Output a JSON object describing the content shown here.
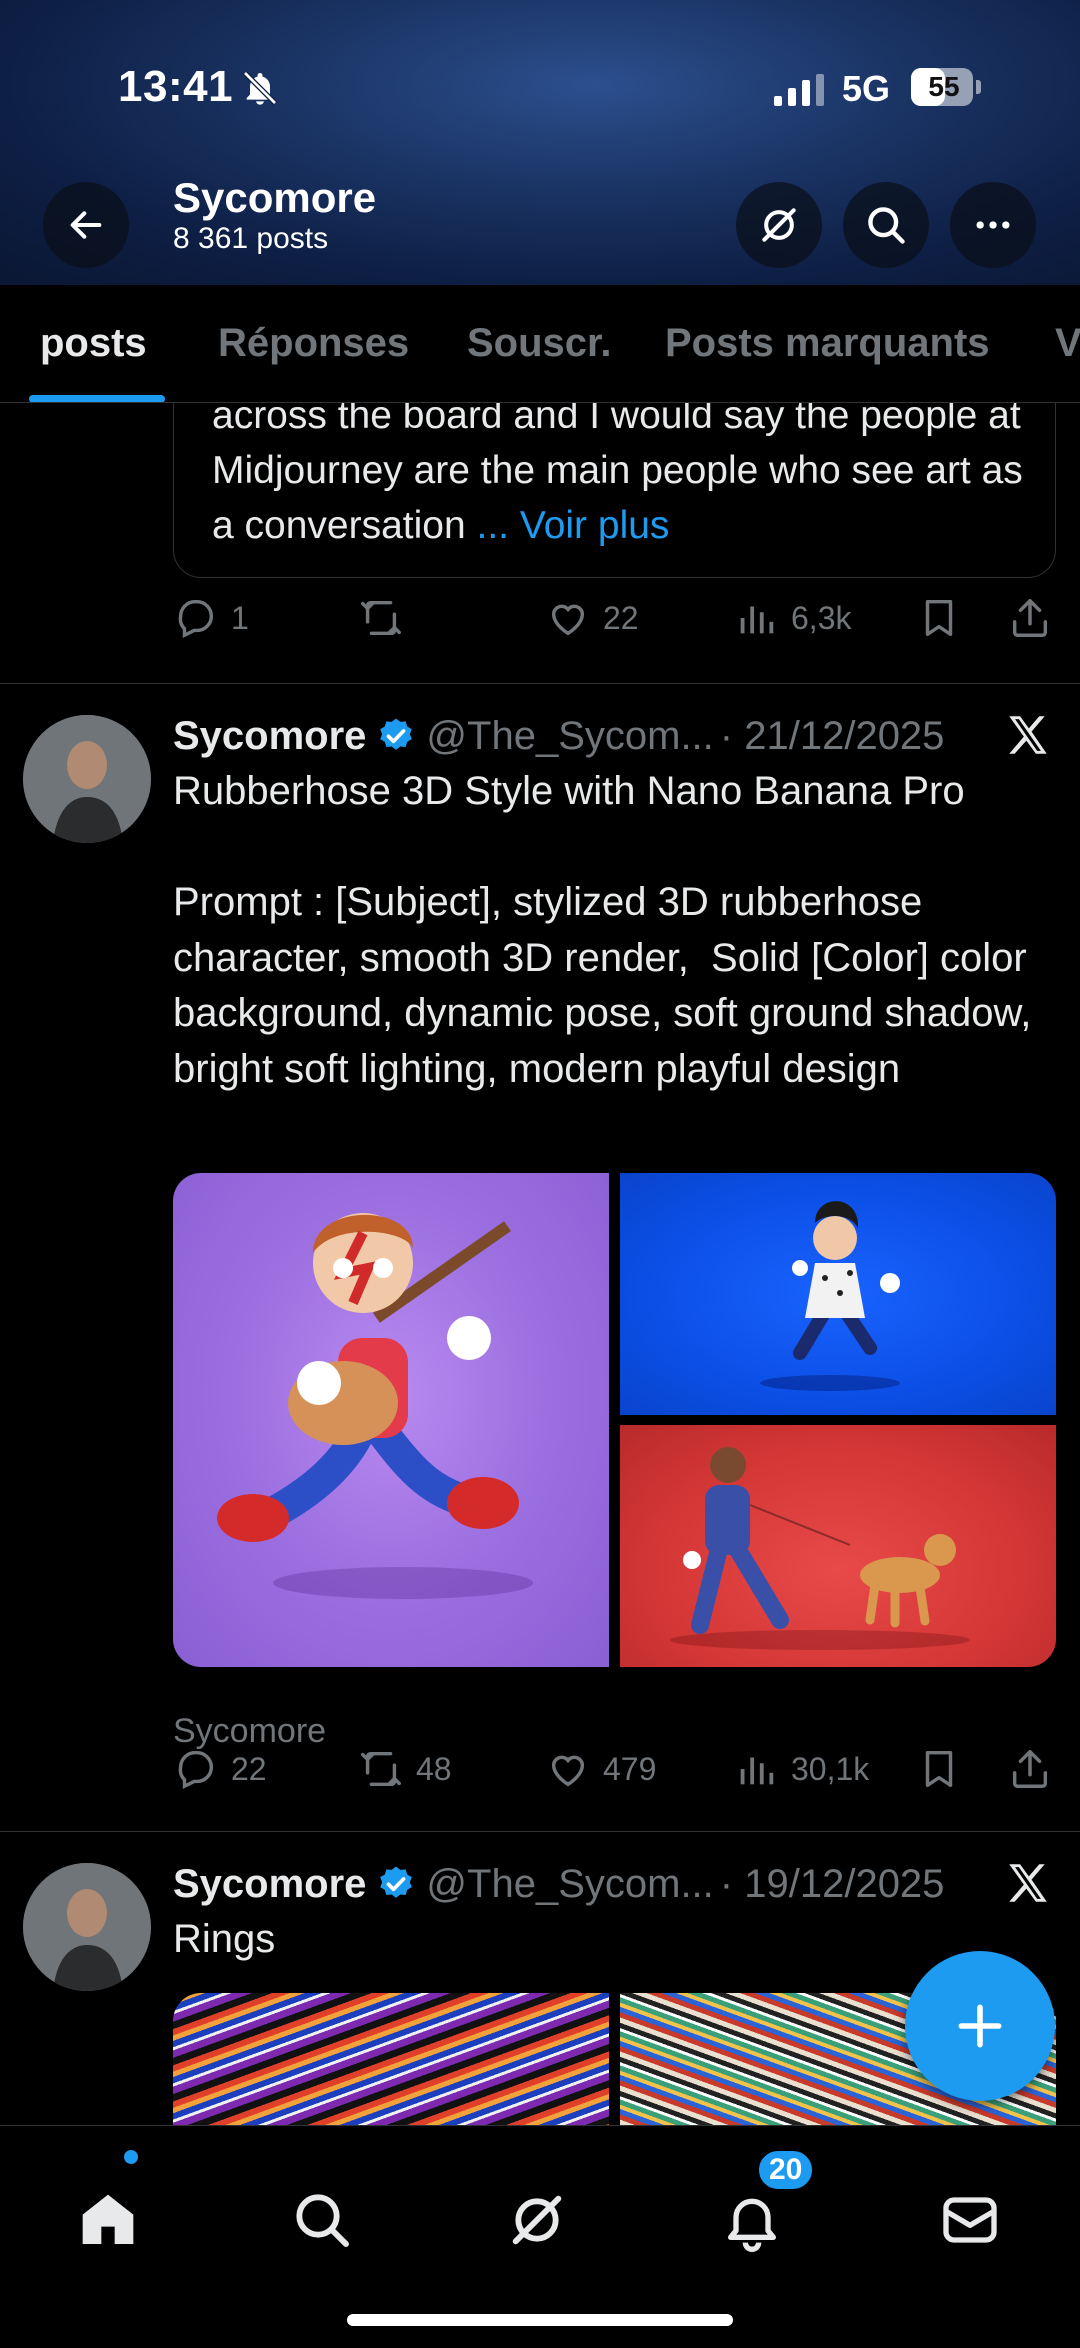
{
  "status_bar": {
    "time": "13:41",
    "network": "5G",
    "battery": "55",
    "battery_level": 0.55
  },
  "header": {
    "name": "Sycomore",
    "post_count": "8 361 posts"
  },
  "tabs": [
    {
      "label": "posts",
      "active": true
    },
    {
      "label": "Réponses"
    },
    {
      "label": "Souscr."
    },
    {
      "label": "Posts marquants"
    },
    {
      "label": "V"
    }
  ],
  "quoted_post": {
    "text": "across the board and I would say the people at Midjourney are the main people who see art as a conversation",
    "more_label": "... Voir plus"
  },
  "post0_actions": {
    "replies": "1",
    "reposts": "",
    "likes": "22",
    "views": "6,3k"
  },
  "posts": [
    {
      "name": "Sycomore",
      "handle": "@The_Sycom...",
      "date": "· 21/12/2025",
      "text": "Rubberhose 3D Style with Nano Banana Pro\n\nPrompt : [Subject], stylized 3D rubberhose character, smooth 3D render,  Solid [Color] color background, dynamic pose, soft ground shadow, bright soft lighting, modern playful design",
      "media_credit": "Sycomore",
      "replies": "22",
      "reposts": "48",
      "likes": "479",
      "views": "30,1k"
    },
    {
      "name": "Sycomore",
      "handle": "@The_Sycom...",
      "date": "· 19/12/2025",
      "text": "Rings"
    }
  ],
  "bottom_nav": {
    "notifications_badge": "20"
  },
  "colors": {
    "accent": "#1d9bf0",
    "background": "#000000",
    "secondary_text": "#71767b"
  },
  "icons": [
    "back-arrow-icon",
    "grok-icon",
    "search-icon",
    "more-icon",
    "reply-icon",
    "repost-icon",
    "like-icon",
    "views-icon",
    "bookmark-icon",
    "share-icon",
    "verified-icon",
    "x-logo-icon",
    "plus-icon",
    "home-icon",
    "bell-icon",
    "mail-icon"
  ]
}
